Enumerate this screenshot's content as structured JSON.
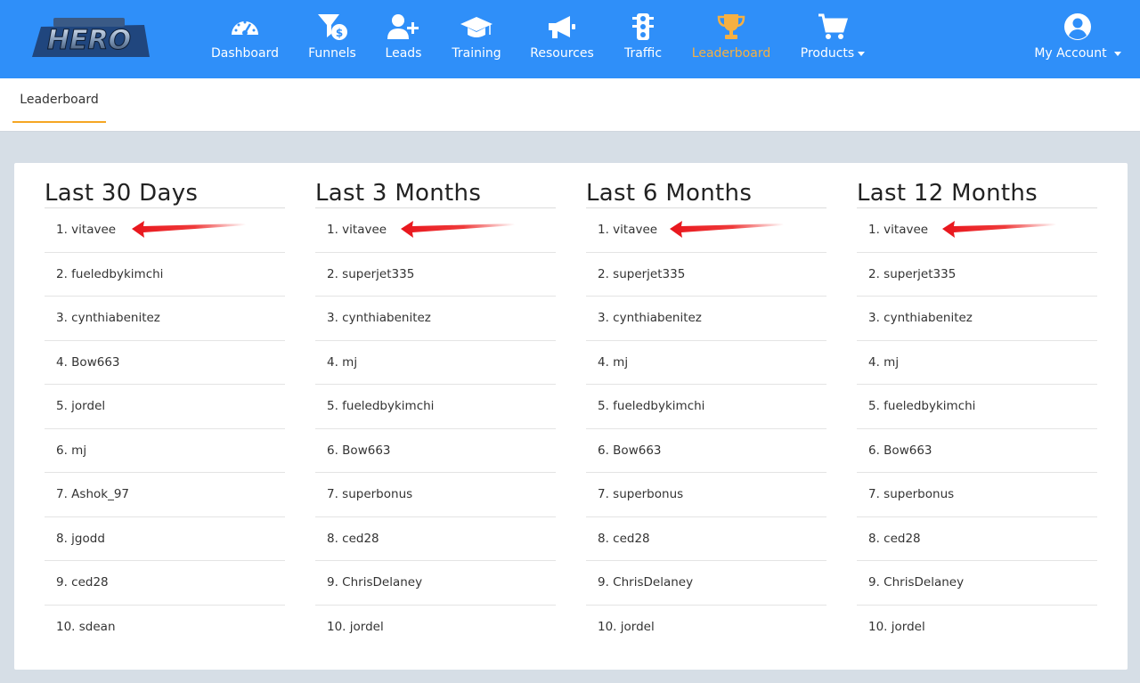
{
  "nav": {
    "logo_name": "hero-logo",
    "items": [
      {
        "label": "Dashboard",
        "icon": "speedometer-icon"
      },
      {
        "label": "Funnels",
        "icon": "funnel-dollar-icon"
      },
      {
        "label": "Leads",
        "icon": "user-plus-icon"
      },
      {
        "label": "Training",
        "icon": "graduation-cap-icon"
      },
      {
        "label": "Resources",
        "icon": "megaphone-icon"
      },
      {
        "label": "Traffic",
        "icon": "traffic-light-icon"
      },
      {
        "label": "Leaderboard",
        "icon": "trophy-icon"
      },
      {
        "label": "Products",
        "icon": "cart-icon"
      }
    ],
    "account_label": "My Account",
    "active_item": "Leaderboard",
    "colors": {
      "bar": "#2f8ff9",
      "active": "#f6b042",
      "text": "#ffffff"
    }
  },
  "tabbar": {
    "tab_label": "Leaderboard",
    "underline_color": "#f5a623"
  },
  "leaderboards": [
    {
      "title": "Last 30 Days",
      "entries": [
        "1. vitavee",
        "2. fueledbykimchi",
        "3. cynthiabenitez",
        "4. Bow663",
        "5. jordel",
        "6. mj",
        "7. Ashok_97",
        "8. jgodd",
        "9. ced28",
        "10. sdean"
      ]
    },
    {
      "title": "Last 3 Months",
      "entries": [
        "1. vitavee",
        "2. superjet335",
        "3. cynthiabenitez",
        "4. mj",
        "5. fueledbykimchi",
        "6. Bow663",
        "7. superbonus",
        "8. ced28",
        "9. ChrisDelaney",
        "10. jordel"
      ]
    },
    {
      "title": "Last 6 Months",
      "entries": [
        "1. vitavee",
        "2. superjet335",
        "3. cynthiabenitez",
        "4. mj",
        "5. fueledbykimchi",
        "6. Bow663",
        "7. superbonus",
        "8. ced28",
        "9. ChrisDelaney",
        "10. jordel"
      ]
    },
    {
      "title": "Last 12 Months",
      "entries": [
        "1. vitavee",
        "2. superjet335",
        "3. cynthiabenitez",
        "4. mj",
        "5. fueledbykimchi",
        "6. Bow663",
        "7. superbonus",
        "8. ced28",
        "9. ChrisDelaney",
        "10. jordel"
      ]
    }
  ],
  "annotation": {
    "icon": "red-arrow-icon",
    "color": "#e8141b"
  }
}
